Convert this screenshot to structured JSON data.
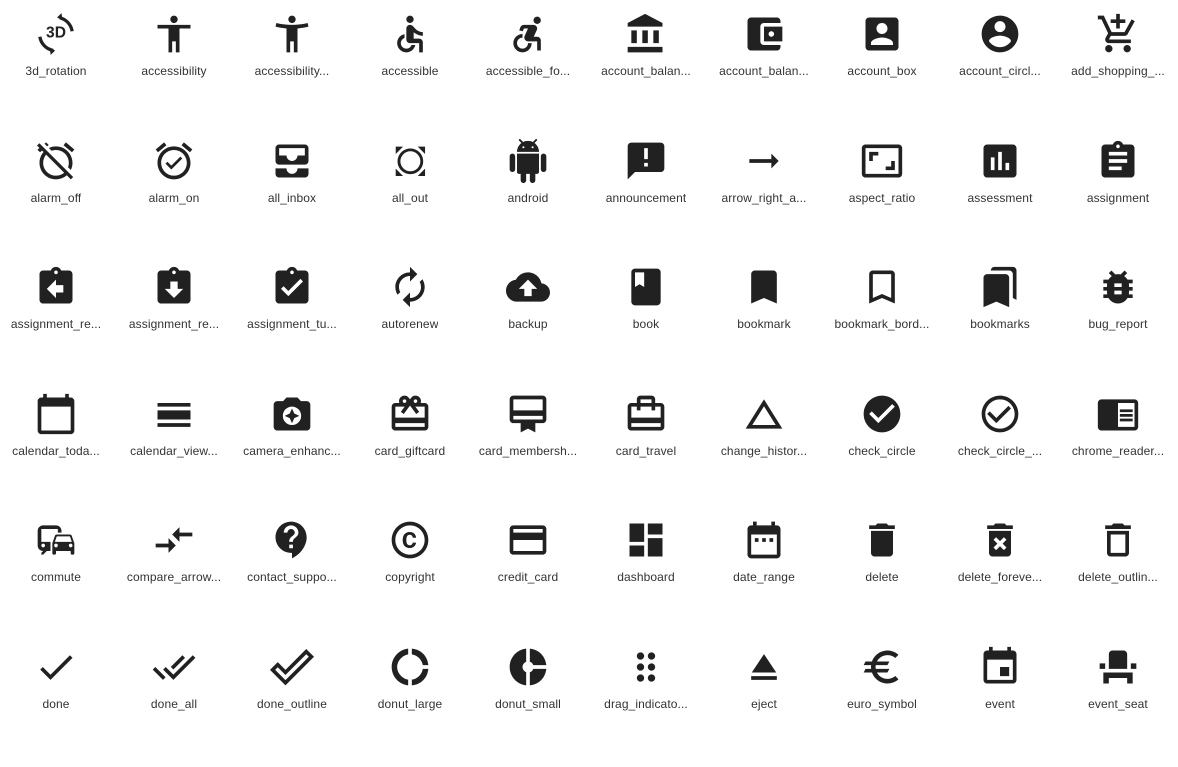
{
  "icon_color": "#212121",
  "label_color": "#333333",
  "icons": [
    {
      "id": "3d_rotation",
      "label": "3d_rotation"
    },
    {
      "id": "accessibility",
      "label": "accessibility"
    },
    {
      "id": "accessibility_new",
      "label": "accessibility..."
    },
    {
      "id": "accessible",
      "label": "accessible"
    },
    {
      "id": "accessible_forward",
      "label": "accessible_fo..."
    },
    {
      "id": "account_balance",
      "label": "account_balan..."
    },
    {
      "id": "account_balance_wallet",
      "label": "account_balan..."
    },
    {
      "id": "account_box",
      "label": "account_box"
    },
    {
      "id": "account_circle",
      "label": "account_circl..."
    },
    {
      "id": "add_shopping_cart",
      "label": "add_shopping_..."
    },
    {
      "id": "alarm_off",
      "label": "alarm_off"
    },
    {
      "id": "alarm_on",
      "label": "alarm_on"
    },
    {
      "id": "all_inbox",
      "label": "all_inbox"
    },
    {
      "id": "all_out",
      "label": "all_out"
    },
    {
      "id": "android",
      "label": "android"
    },
    {
      "id": "announcement",
      "label": "announcement"
    },
    {
      "id": "arrow_right_alt",
      "label": "arrow_right_a..."
    },
    {
      "id": "aspect_ratio",
      "label": "aspect_ratio"
    },
    {
      "id": "assessment",
      "label": "assessment"
    },
    {
      "id": "assignment",
      "label": "assignment"
    },
    {
      "id": "assignment_return",
      "label": "assignment_re..."
    },
    {
      "id": "assignment_returned",
      "label": "assignment_re..."
    },
    {
      "id": "assignment_turned_in",
      "label": "assignment_tu..."
    },
    {
      "id": "autorenew",
      "label": "autorenew"
    },
    {
      "id": "backup",
      "label": "backup"
    },
    {
      "id": "book",
      "label": "book"
    },
    {
      "id": "bookmark",
      "label": "bookmark"
    },
    {
      "id": "bookmark_border",
      "label": "bookmark_bord..."
    },
    {
      "id": "bookmarks",
      "label": "bookmarks"
    },
    {
      "id": "bug_report",
      "label": "bug_report"
    },
    {
      "id": "calendar_today",
      "label": "calendar_toda..."
    },
    {
      "id": "calendar_view_day",
      "label": "calendar_view..."
    },
    {
      "id": "camera_enhance",
      "label": "camera_enhanc..."
    },
    {
      "id": "card_giftcard",
      "label": "card_giftcard"
    },
    {
      "id": "card_membership",
      "label": "card_membersh..."
    },
    {
      "id": "card_travel",
      "label": "card_travel"
    },
    {
      "id": "change_history",
      "label": "change_histor..."
    },
    {
      "id": "check_circle",
      "label": "check_circle"
    },
    {
      "id": "check_circle_outline",
      "label": "check_circle_..."
    },
    {
      "id": "chrome_reader_mode",
      "label": "chrome_reader..."
    },
    {
      "id": "commute",
      "label": "commute"
    },
    {
      "id": "compare_arrows",
      "label": "compare_arrow..."
    },
    {
      "id": "contact_support",
      "label": "contact_suppo..."
    },
    {
      "id": "copyright",
      "label": "copyright"
    },
    {
      "id": "credit_card",
      "label": "credit_card"
    },
    {
      "id": "dashboard",
      "label": "dashboard"
    },
    {
      "id": "date_range",
      "label": "date_range"
    },
    {
      "id": "delete",
      "label": "delete"
    },
    {
      "id": "delete_forever",
      "label": "delete_foreve..."
    },
    {
      "id": "delete_outline",
      "label": "delete_outlin..."
    },
    {
      "id": "done",
      "label": "done"
    },
    {
      "id": "done_all",
      "label": "done_all"
    },
    {
      "id": "done_outline",
      "label": "done_outline"
    },
    {
      "id": "donut_large",
      "label": "donut_large"
    },
    {
      "id": "donut_small",
      "label": "donut_small"
    },
    {
      "id": "drag_indicator",
      "label": "drag_indicato..."
    },
    {
      "id": "eject",
      "label": "eject"
    },
    {
      "id": "euro_symbol",
      "label": "euro_symbol"
    },
    {
      "id": "event",
      "label": "event"
    },
    {
      "id": "event_seat",
      "label": "event_seat"
    }
  ]
}
